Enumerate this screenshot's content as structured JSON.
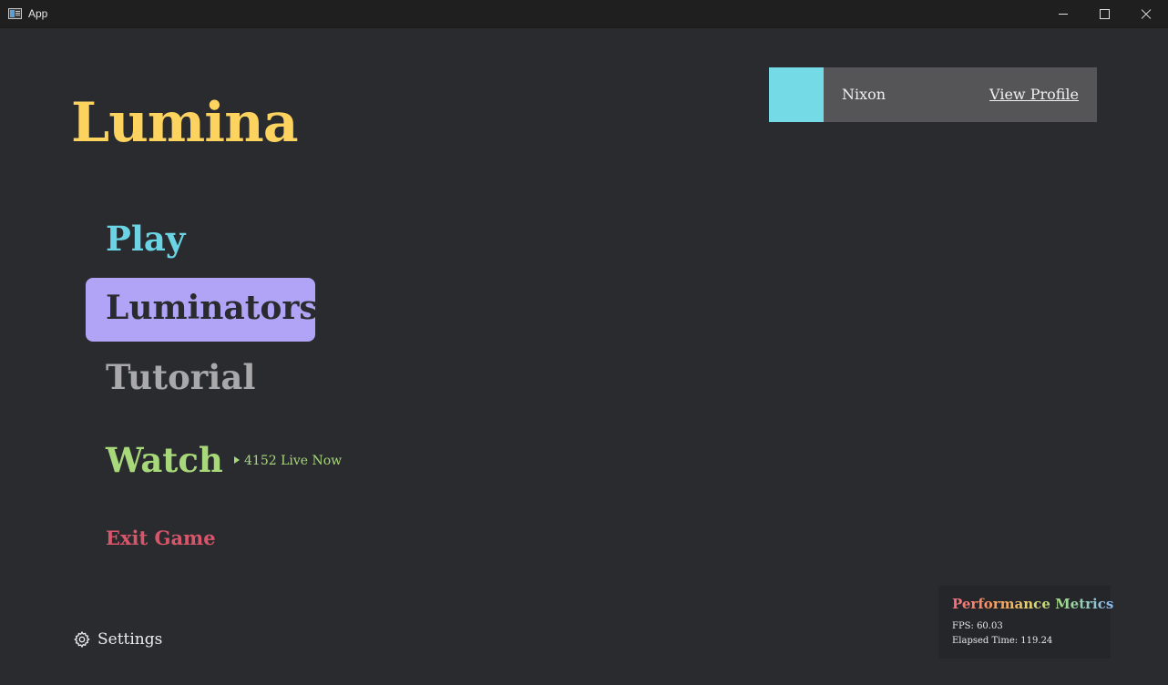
{
  "window": {
    "title": "App",
    "controls": [
      "minimize",
      "maximize",
      "close"
    ]
  },
  "game": {
    "title": "Lumina"
  },
  "menu": {
    "play": "Play",
    "luminators": "Luminators",
    "tutorial": "Tutorial",
    "watch": "Watch",
    "live_count": "4152 Live Now",
    "exit": "Exit Game",
    "selected": "Luminators"
  },
  "settings": {
    "label": "Settings",
    "icon": "gear-icon"
  },
  "profile": {
    "name": "Nixon",
    "link": "View Profile",
    "avatar_color": "#74dbe6"
  },
  "metrics": {
    "title": "Performance Metrics",
    "fps": "FPS: 60.03",
    "elapsed": "Elapsed Time: 119.24"
  },
  "colors": {
    "background": "#2a2b2f",
    "title": "#fcd35f",
    "play": "#6ad3e4",
    "luminators_bg": "#b1a4f7",
    "tutorial": "#a9a9ab",
    "watch": "#a7d97a",
    "exit": "#d8566b"
  }
}
